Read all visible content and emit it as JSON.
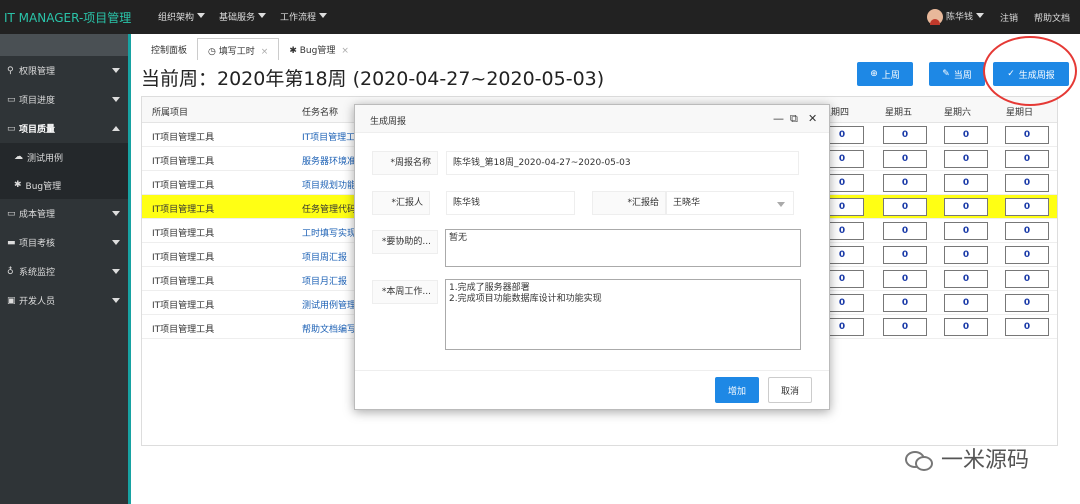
{
  "app": {
    "brand": "IT MANAGER-项目管理",
    "nav": [
      "组织架构",
      "基础服务",
      "工作流程"
    ],
    "user": "陈华钱",
    "logout": "注销",
    "help": "帮助文档"
  },
  "sidebar": {
    "items": [
      {
        "label": "权限管理",
        "icon": "key-icon",
        "expanded": false
      },
      {
        "label": "项目进度",
        "icon": "folder-icon",
        "expanded": false
      },
      {
        "label": "项目质量",
        "icon": "folder-icon",
        "expanded": true
      },
      {
        "label": "成本管理",
        "icon": "folder-icon",
        "expanded": false
      },
      {
        "label": "项目考核",
        "icon": "monitor-icon",
        "expanded": false
      },
      {
        "label": "系统监控",
        "icon": "bulb-icon",
        "expanded": false
      },
      {
        "label": "开发人员",
        "icon": "image-icon",
        "expanded": false
      }
    ],
    "subitems": [
      {
        "label": "测试用例",
        "icon": "cloud-icon"
      },
      {
        "label": "Bug管理",
        "icon": "bug-icon"
      }
    ]
  },
  "tabs": [
    {
      "label": "控制面板"
    },
    {
      "label": "填写工时",
      "icon": "clock-icon",
      "closable": true
    },
    {
      "label": "Bug管理",
      "icon": "bug-icon",
      "closable": true
    }
  ],
  "page": {
    "title": "当前周：2020年第18周 (2020-04-27~2020-05-03)",
    "buttons": {
      "prev": "上周",
      "current": "当周",
      "generate": "生成周报"
    }
  },
  "table": {
    "headers": {
      "project": "所属项目",
      "task": "任务名称",
      "thu": "星期四",
      "fri": "星期五",
      "sat": "星期六",
      "sun": "星期日"
    },
    "rows": [
      {
        "project": "IT项目管理工具",
        "task": "IT项目管理工",
        "thu": "0",
        "fri": "0",
        "sat": "0",
        "sun": "0",
        "highlight": false
      },
      {
        "project": "IT项目管理工具",
        "task": "服务器环境准",
        "thu": "0",
        "fri": "0",
        "sat": "0",
        "sun": "0",
        "highlight": false
      },
      {
        "project": "IT项目管理工具",
        "task": "项目规划功能",
        "thu": "0",
        "fri": "0",
        "sat": "0",
        "sun": "0",
        "highlight": false
      },
      {
        "project": "IT项目管理工具",
        "task": "任务管理代码",
        "thu": "0",
        "fri": "0",
        "sat": "0",
        "sun": "0",
        "highlight": true
      },
      {
        "project": "IT项目管理工具",
        "task": "工时填写实现",
        "thu": "0",
        "fri": "0",
        "sat": "0",
        "sun": "0",
        "highlight": false
      },
      {
        "project": "IT项目管理工具",
        "task": "项目周汇报",
        "thu": "0",
        "fri": "0",
        "sat": "0",
        "sun": "0",
        "highlight": false
      },
      {
        "project": "IT项目管理工具",
        "task": "项目月汇报",
        "thu": "0",
        "fri": "0",
        "sat": "0",
        "sun": "0",
        "highlight": false
      },
      {
        "project": "IT项目管理工具",
        "task": "测试用例管理",
        "thu": "0",
        "fri": "0",
        "sat": "0",
        "sun": "0",
        "highlight": false
      },
      {
        "project": "IT项目管理工具",
        "task": "帮助文档编写",
        "thu": "0",
        "fri": "0",
        "sat": "0",
        "sun": "0",
        "highlight": false
      }
    ]
  },
  "modal": {
    "title": "生成周报",
    "name_label": "*周报名称",
    "name_value": "陈华钱_第18周_2020-04-27~2020-05-03",
    "reporter_label": "*汇报人",
    "reporter_value": "陈华钱",
    "report_to_label": "*汇报给",
    "report_to_value": "王晓华",
    "help_label": "*要协助的...",
    "help_value": "暂无",
    "work_label": "*本周工作...",
    "work_lines": [
      "1.完成了服务器部署",
      "2.完成项目功能数据库设计和功能实现"
    ],
    "add": "增加",
    "cancel": "取消"
  },
  "watermark": "一米源码"
}
